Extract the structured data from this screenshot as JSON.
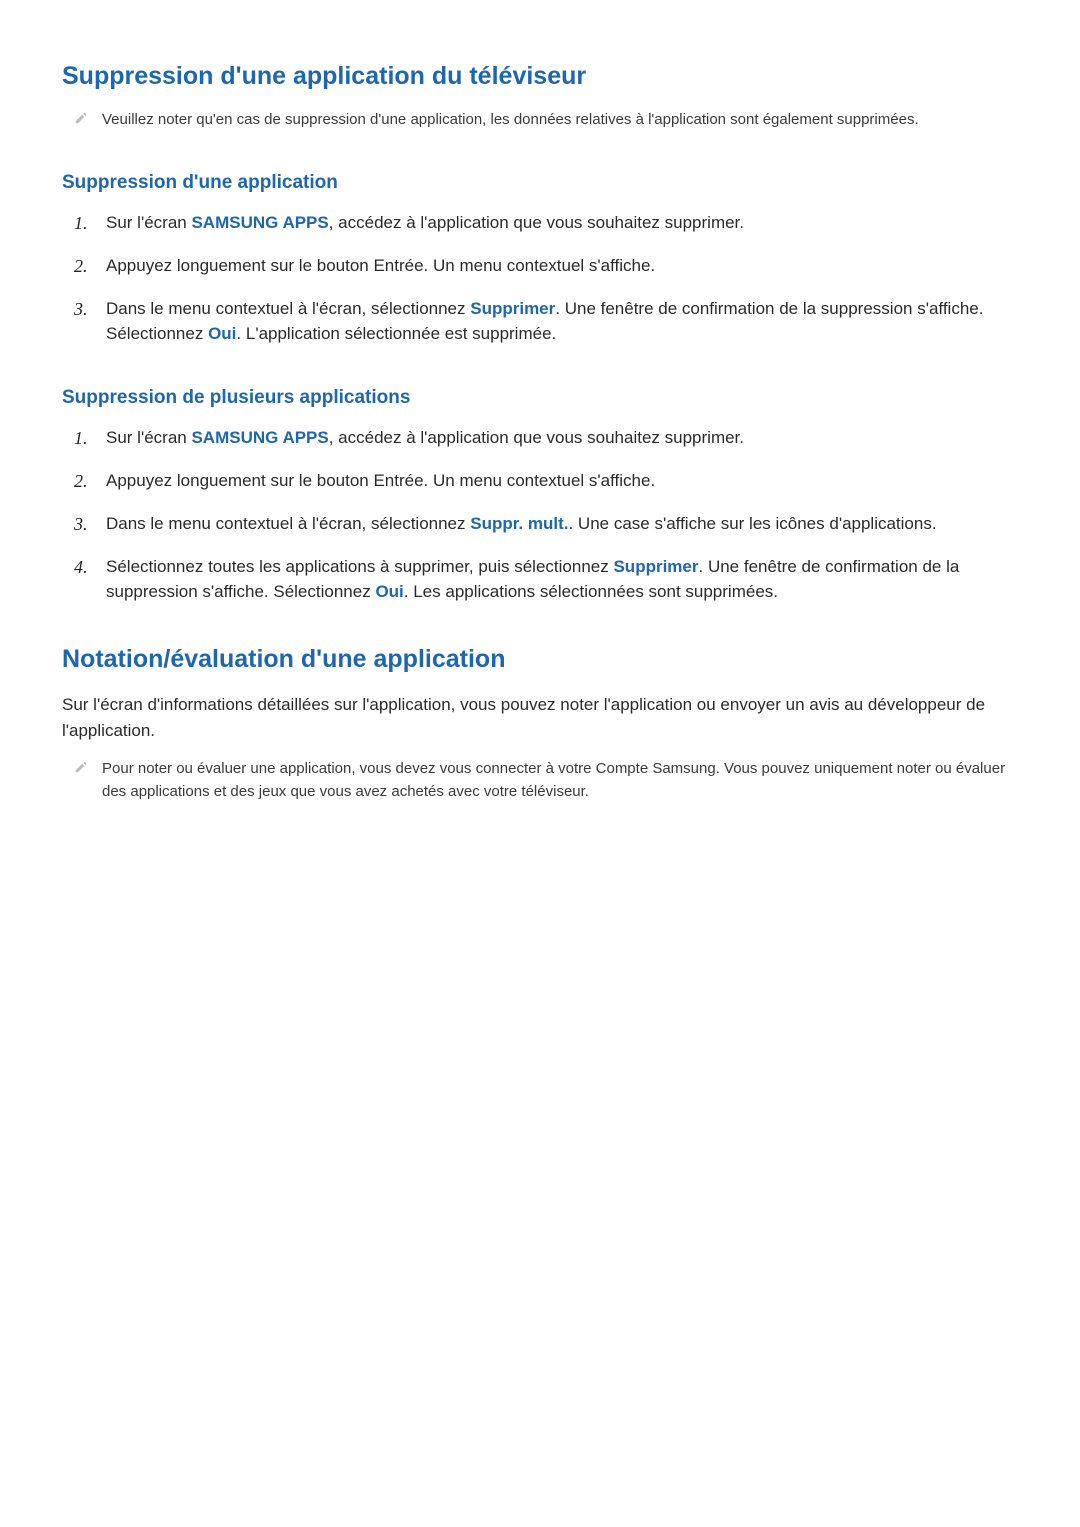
{
  "section1": {
    "title": "Suppression d'une application du téléviseur",
    "note": "Veuillez noter qu'en cas de suppression d'une application, les données relatives à l'application sont également supprimées.",
    "sub1": {
      "title": "Suppression d'une application",
      "steps": {
        "s1a": "Sur l'écran ",
        "s1link": "SAMSUNG APPS",
        "s1b": ", accédez à l'application que vous souhaitez supprimer.",
        "s2": "Appuyez longuement sur le bouton Entrée. Un menu contextuel s'affiche.",
        "s3a": "Dans le menu contextuel à l'écran, sélectionnez ",
        "s3link1": "Supprimer",
        "s3b": ". Une fenêtre de confirmation de la suppression s'affiche. Sélectionnez ",
        "s3link2": "Oui",
        "s3c": ". L'application sélectionnée est supprimée."
      }
    },
    "sub2": {
      "title": "Suppression de plusieurs applications",
      "steps": {
        "s1a": "Sur l'écran ",
        "s1link": "SAMSUNG APPS",
        "s1b": ", accédez à l'application que vous souhaitez supprimer.",
        "s2": "Appuyez longuement sur le bouton Entrée. Un menu contextuel s'affiche.",
        "s3a": "Dans le menu contextuel à l'écran, sélectionnez ",
        "s3link": "Suppr. mult.",
        "s3b": ". Une case s'affiche sur les icônes d'applications.",
        "s4a": "Sélectionnez toutes les applications à supprimer, puis sélectionnez ",
        "s4link1": "Supprimer",
        "s4b": ". Une fenêtre de confirmation de la suppression s'affiche. Sélectionnez ",
        "s4link2": "Oui",
        "s4c": ". Les applications sélectionnées sont supprimées."
      }
    }
  },
  "section2": {
    "title": "Notation/évaluation d'une application",
    "para": "Sur l'écran d'informations détaillées sur l'application, vous pouvez noter l'application ou envoyer un avis au développeur de l'application.",
    "note": "Pour noter ou évaluer une application, vous devez vous connecter à votre Compte Samsung. Vous pouvez uniquement noter ou évaluer des applications et des jeux que vous avez achetés avec votre téléviseur."
  },
  "nums": {
    "n1": "1.",
    "n2": "2.",
    "n3": "3.",
    "n4": "4."
  }
}
